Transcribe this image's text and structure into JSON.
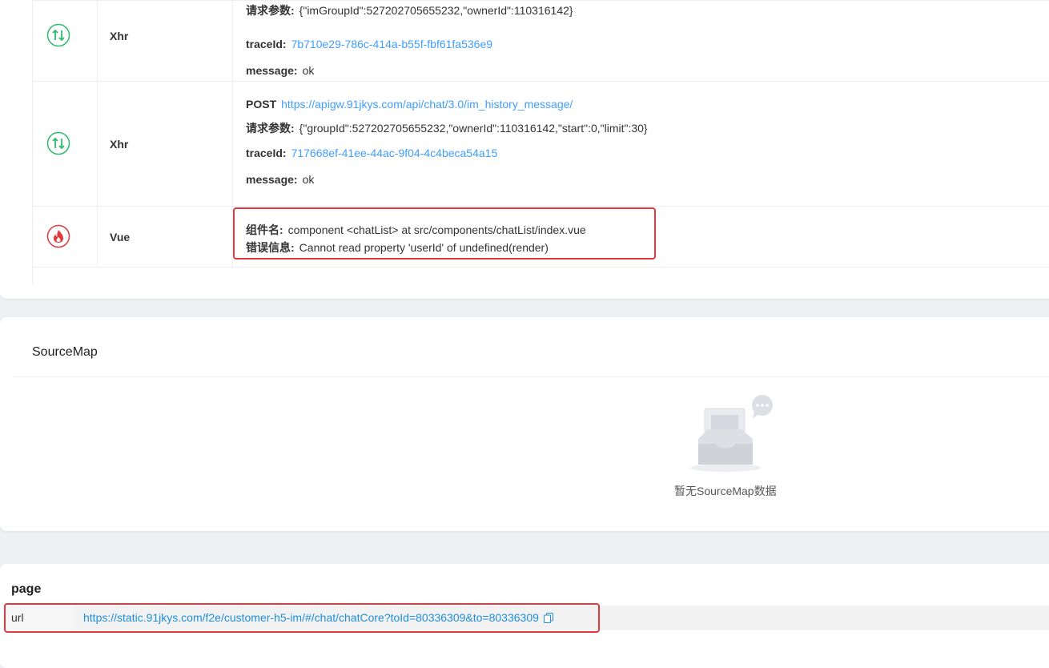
{
  "events": [
    {
      "icon": "xhr-refresh-icon",
      "type": "Xhr",
      "lines": [
        {
          "label": "请求参数:",
          "value": "{\"imGroupId\":527202705655232,\"ownerId\":110316142}"
        },
        {
          "label": "traceId:",
          "value": "7b710e29-786c-414a-b55f-fbf61fa536e9"
        },
        {
          "label": "message:",
          "value": "ok"
        }
      ]
    },
    {
      "icon": "xhr-refresh-icon",
      "type": "Xhr",
      "method": "POST",
      "url": "https://apigw.91jkys.com/api/chat/3.0/im_history_message/",
      "lines": [
        {
          "label": "请求参数:",
          "value": "{\"groupId\":527202705655232,\"ownerId\":110316142,\"start\":0,\"limit\":30}"
        },
        {
          "label": "traceId:",
          "value": "717668ef-41ee-44ac-9f04-4c4beca54a15"
        },
        {
          "label": "message:",
          "value": "ok"
        }
      ]
    },
    {
      "icon": "fire-error-icon",
      "type": "Vue",
      "lines": [
        {
          "label": "组件名:",
          "value": "component <chatList> at src/components/chatList/index.vue"
        },
        {
          "label": "错误信息:",
          "value": "Cannot read property 'userId' of undefined(render)"
        }
      ]
    }
  ],
  "sourcemap": {
    "title": "SourceMap",
    "empty_text": "暂无SourceMap数据"
  },
  "page": {
    "title": "page",
    "url_key": "url",
    "url_value": "https://static.91jkys.com/f2e/customer-h5-im/#/chat/chatCore?toId=80336309&to=80336309"
  },
  "colors": {
    "accent_link": "#409eff",
    "xhr_icon": "#2ebd6b",
    "error_icon": "#e4393c",
    "highlight": "#e4393c"
  }
}
